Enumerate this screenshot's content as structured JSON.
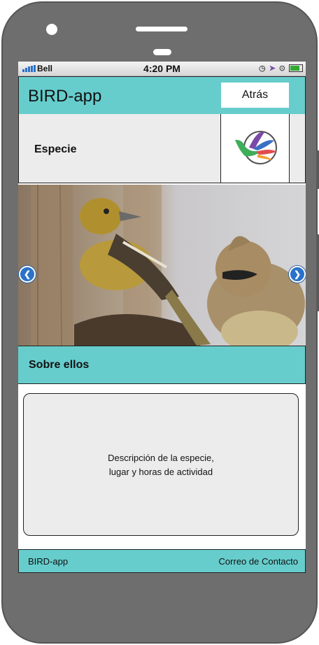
{
  "statusbar": {
    "carrier": "Bell",
    "time": "4:20 PM"
  },
  "header": {
    "title": "BIRD-app",
    "back_label": "Atrás"
  },
  "species": {
    "label": "Especie"
  },
  "about": {
    "label": "Sobre ellos"
  },
  "description": {
    "line1": "Descripción de la especie,",
    "line2": "lugar y horas de actividad"
  },
  "footer": {
    "left": "BIRD-app",
    "right": "Correo de Contacto"
  },
  "colors": {
    "accent": "#66cdcc",
    "panel": "#ececec",
    "arrow": "#2a72c9"
  },
  "icons": [
    "hummingbird-logo-icon",
    "chevron-left-icon",
    "chevron-right-icon",
    "location-arrow-icon",
    "lock-rotation-icon",
    "battery-icon",
    "signal-icon"
  ]
}
